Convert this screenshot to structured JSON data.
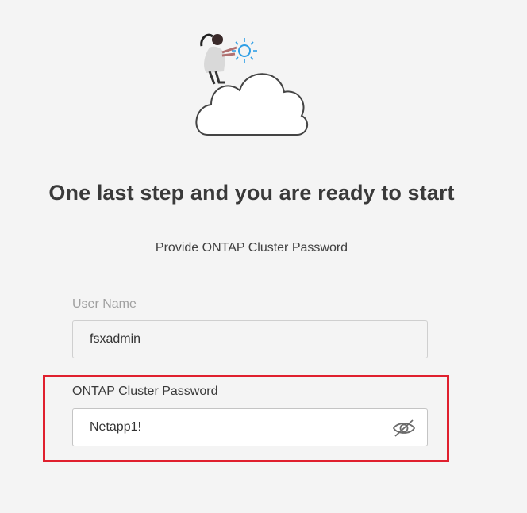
{
  "heading": "One last step and you are ready to start",
  "subheading": "Provide ONTAP Cluster Password",
  "username": {
    "label": "User Name",
    "value": "fsxadmin"
  },
  "password": {
    "label": "ONTAP Cluster Password",
    "value": "Netapp1!",
    "toggle_icon": "eye-slash-icon"
  },
  "colors": {
    "highlight": "#e0202e",
    "accent_blue": "#2f9fe6",
    "background": "#f4f4f4"
  }
}
